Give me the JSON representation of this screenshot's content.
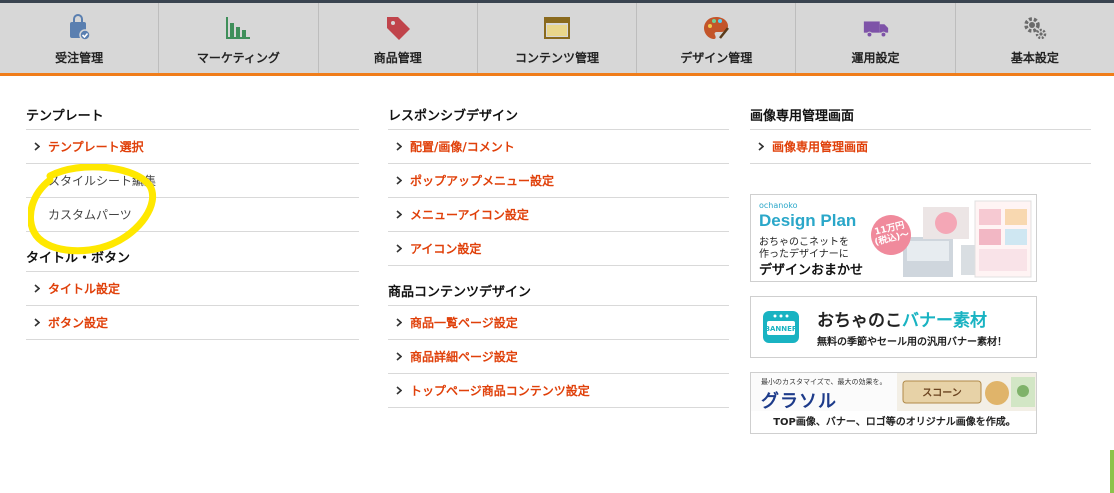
{
  "nav": {
    "items": [
      {
        "label": "受注管理",
        "icon": "order-bag-icon"
      },
      {
        "label": "マーケティング",
        "icon": "bar-chart-icon"
      },
      {
        "label": "商品管理",
        "icon": "price-tag-icon"
      },
      {
        "label": "コンテンツ管理",
        "icon": "window-icon"
      },
      {
        "label": "デザイン管理",
        "icon": "palette-icon"
      },
      {
        "label": "運用設定",
        "icon": "truck-icon"
      },
      {
        "label": "基本設定",
        "icon": "gears-icon"
      }
    ]
  },
  "col1": {
    "sections": [
      {
        "title": "テンプレート",
        "items": [
          {
            "label": "テンプレート選択",
            "link": true
          },
          {
            "label": "スタイルシート編集",
            "link": false
          },
          {
            "label": "カスタムパーツ",
            "link": false
          }
        ]
      },
      {
        "title": "タイトル・ボタン",
        "items": [
          {
            "label": "タイトル設定",
            "link": true
          },
          {
            "label": "ボタン設定",
            "link": true
          }
        ]
      }
    ]
  },
  "col2": {
    "sections": [
      {
        "title": "レスポンシブデザイン",
        "items": [
          {
            "label": "配置/画像/コメント",
            "link": true
          },
          {
            "label": "ポップアップメニュー設定",
            "link": true
          },
          {
            "label": "メニューアイコン設定",
            "link": true
          },
          {
            "label": "アイコン設定",
            "link": true
          }
        ]
      },
      {
        "title": "商品コンテンツデザイン",
        "items": [
          {
            "label": "商品一覧ページ設定",
            "link": true
          },
          {
            "label": "商品詳細ページ設定",
            "link": true
          },
          {
            "label": "トップページ商品コンテンツ設定",
            "link": true
          }
        ]
      }
    ]
  },
  "col3": {
    "sections": [
      {
        "title": "画像専用管理画面",
        "items": [
          {
            "label": "画像専用管理画面",
            "link": true
          }
        ]
      }
    ]
  },
  "banners": {
    "design_plan": {
      "small": "ochanoko",
      "big": "Design Plan",
      "sub1": "おちゃのこネットを",
      "sub2": "作ったデザイナーに",
      "main": "デザインおまかせ",
      "badge": "11万円(税込)〜"
    },
    "banner_material": {
      "icon_text": "BANNER",
      "title_a": "おちゃのこ",
      "title_b": "バナー素材",
      "sub": "無料の季節やセール用の汎用バナー素材！"
    },
    "graphol": {
      "tagline": "最小のカスタマイズで、最大の効果を。",
      "logo": "グラソル",
      "art_text": "スコーン",
      "sub": "TOP画像、バナー、ロゴ等のオリジナル画像を作成。"
    }
  },
  "colors": {
    "accent_orange": "#f07d1a",
    "link_red": "#e0400a",
    "annotation_yellow": "#ffe800",
    "nav_bg": "#d7d7d7"
  }
}
